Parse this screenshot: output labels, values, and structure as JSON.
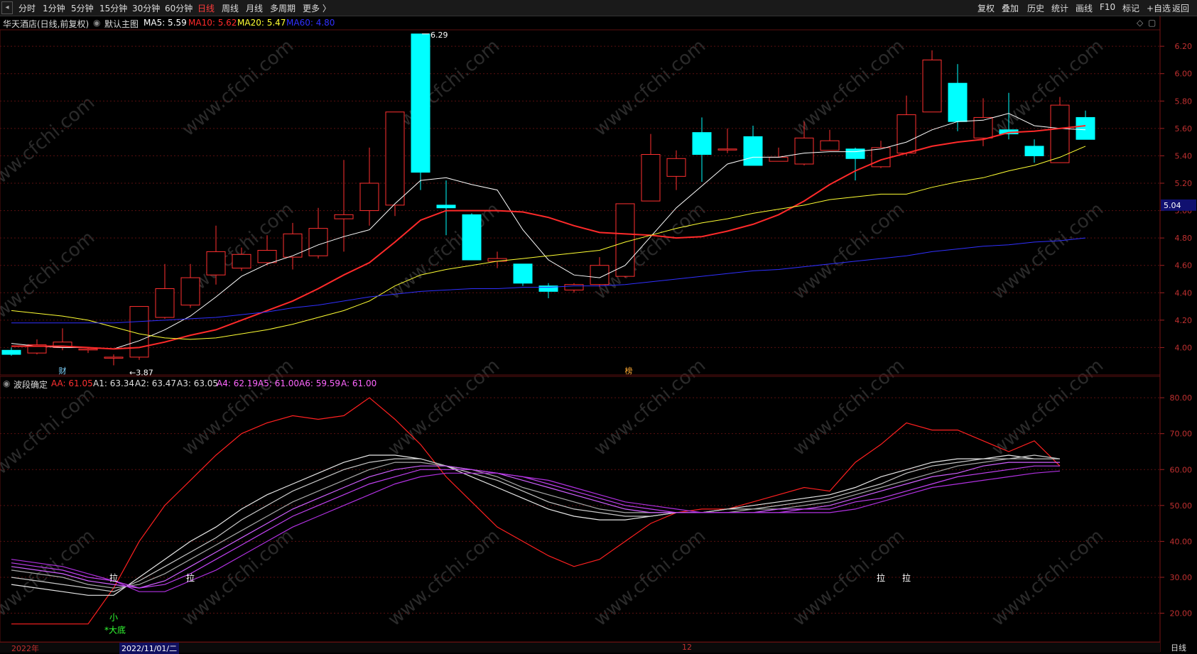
{
  "toolbar": {
    "periods": [
      "分时",
      "1分钟",
      "5分钟",
      "15分钟",
      "30分钟",
      "60分钟",
      "日线",
      "周线",
      "月线",
      "多周期",
      "更多"
    ],
    "active_period": "日线",
    "more_arrow": "〉",
    "right_tools": [
      "复权",
      "叠加",
      "历史",
      "统计",
      "画线",
      "F10",
      "标记",
      "+自选",
      "返回"
    ]
  },
  "main_panel": {
    "stock_name": "华天酒店(日线,前复权)",
    "template": "默认主图",
    "ma": [
      {
        "label": "MA5: 5.59",
        "color": "#ffffff"
      },
      {
        "label": "MA10: 5.62",
        "color": "#ff2a2a"
      },
      {
        "label": "MA20: 5.47",
        "color": "#ffff33"
      },
      {
        "label": "MA60: 4.80",
        "color": "#3030ff"
      }
    ],
    "high_label": "6.29",
    "low_label": "3.87",
    "current_price": "5.04",
    "badge_cai": "财",
    "badge_bang": "榜"
  },
  "indicator_panel": {
    "name": "波段确定",
    "values": [
      {
        "label": "AA: 61.05",
        "color": "#ff3030"
      },
      {
        "label": "A1: 63.34",
        "color": "#dddddd"
      },
      {
        "label": "A2: 63.47",
        "color": "#dddddd"
      },
      {
        "label": "A3: 63.05",
        "color": "#dddddd"
      },
      {
        "label": "A4: 62.19",
        "color": "#ff66ff"
      },
      {
        "label": "A5: 61.00",
        "color": "#ff66ff"
      },
      {
        "label": "A6: 59.59",
        "color": "#ff66ff"
      },
      {
        "label": "A: 61.00",
        "color": "#ff66ff"
      }
    ],
    "signals": [
      {
        "text": "拉",
        "i": 4
      },
      {
        "text": "拉",
        "i": 7
      },
      {
        "text": "拉",
        "i": 34
      },
      {
        "text": "拉",
        "i": 35
      }
    ],
    "small_label": "小",
    "bottom_label": "*大底"
  },
  "watermark": "www.cfchi.com",
  "x_axis": {
    "year_label": "2022年",
    "cursor_date": "2022/11/01/二",
    "month_label": "12",
    "period_label": "日线"
  },
  "chart_data": [
    {
      "type": "candlestick",
      "title": "华天酒店(日线,前复权)",
      "ylim": [
        3.8,
        6.32
      ],
      "yticks": [
        4.0,
        4.2,
        4.4,
        4.6,
        4.8,
        5.0,
        5.2,
        5.4,
        5.6,
        5.8,
        6.0,
        6.2
      ],
      "candles": [
        {
          "o": 3.98,
          "c": 3.95,
          "h": 4.0,
          "l": 3.94
        },
        {
          "o": 3.96,
          "c": 4.02,
          "h": 4.06,
          "l": 3.95
        },
        {
          "o": 4.0,
          "c": 4.04,
          "h": 4.14,
          "l": 3.98
        },
        {
          "o": 3.99,
          "c": 3.99,
          "h": 4.0,
          "l": 3.96
        },
        {
          "o": 3.93,
          "c": 3.93,
          "h": 3.95,
          "l": 3.87
        },
        {
          "o": 3.93,
          "c": 4.3,
          "h": 4.3,
          "l": 3.91
        },
        {
          "o": 4.22,
          "c": 4.43,
          "h": 4.61,
          "l": 4.21
        },
        {
          "o": 4.31,
          "c": 4.51,
          "h": 4.61,
          "l": 4.29
        },
        {
          "o": 4.53,
          "c": 4.7,
          "h": 4.89,
          "l": 4.46
        },
        {
          "o": 4.58,
          "c": 4.68,
          "h": 4.73,
          "l": 4.56
        },
        {
          "o": 4.62,
          "c": 4.71,
          "h": 4.82,
          "l": 4.6
        },
        {
          "o": 4.66,
          "c": 4.83,
          "h": 4.91,
          "l": 4.57
        },
        {
          "o": 4.67,
          "c": 4.87,
          "h": 5.02,
          "l": 4.65
        },
        {
          "o": 4.94,
          "c": 4.97,
          "h": 5.37,
          "l": 4.7
        },
        {
          "o": 5.0,
          "c": 5.2,
          "h": 5.46,
          "l": 4.89
        },
        {
          "o": 5.04,
          "c": 5.72,
          "h": 5.72,
          "l": 4.96
        },
        {
          "o": 6.29,
          "c": 5.28,
          "h": 6.29,
          "l": 5.15
        },
        {
          "o": 5.04,
          "c": 5.02,
          "h": 5.22,
          "l": 4.82
        },
        {
          "o": 4.97,
          "c": 4.64,
          "h": 4.98,
          "l": 4.64
        },
        {
          "o": 4.63,
          "c": 4.65,
          "h": 4.7,
          "l": 4.58
        },
        {
          "o": 4.61,
          "c": 4.47,
          "h": 4.61,
          "l": 4.45
        },
        {
          "o": 4.45,
          "c": 4.41,
          "h": 4.47,
          "l": 4.36
        },
        {
          "o": 4.42,
          "c": 4.46,
          "h": 4.47,
          "l": 4.4
        },
        {
          "o": 4.46,
          "c": 4.6,
          "h": 4.66,
          "l": 4.44
        },
        {
          "o": 4.52,
          "c": 5.05,
          "h": 5.05,
          "l": 4.51
        },
        {
          "o": 5.07,
          "c": 5.41,
          "h": 5.56,
          "l": 5.07
        },
        {
          "o": 5.25,
          "c": 5.38,
          "h": 5.44,
          "l": 5.15
        },
        {
          "o": 5.57,
          "c": 5.41,
          "h": 5.68,
          "l": 5.21
        },
        {
          "o": 5.45,
          "c": 5.45,
          "h": 5.6,
          "l": 5.42
        },
        {
          "o": 5.54,
          "c": 5.33,
          "h": 5.62,
          "l": 5.33
        },
        {
          "o": 5.36,
          "c": 5.39,
          "h": 5.46,
          "l": 5.36
        },
        {
          "o": 5.34,
          "c": 5.53,
          "h": 5.65,
          "l": 5.33
        },
        {
          "o": 5.44,
          "c": 5.51,
          "h": 5.59,
          "l": 5.44
        },
        {
          "o": 5.45,
          "c": 5.38,
          "h": 5.46,
          "l": 5.22
        },
        {
          "o": 5.32,
          "c": 5.46,
          "h": 5.51,
          "l": 5.31
        },
        {
          "o": 5.42,
          "c": 5.7,
          "h": 5.84,
          "l": 5.4
        },
        {
          "o": 5.72,
          "c": 6.1,
          "h": 6.17,
          "l": 5.72
        },
        {
          "o": 5.93,
          "c": 5.65,
          "h": 6.07,
          "l": 5.58
        },
        {
          "o": 5.53,
          "c": 5.68,
          "h": 5.82,
          "l": 5.47
        },
        {
          "o": 5.59,
          "c": 5.56,
          "h": 5.86,
          "l": 5.52
        },
        {
          "o": 5.47,
          "c": 5.4,
          "h": 5.52,
          "l": 5.35
        },
        {
          "o": 5.35,
          "c": 5.77,
          "h": 5.83,
          "l": 5.35
        },
        {
          "o": 5.68,
          "c": 5.52,
          "h": 5.73,
          "l": 5.52
        }
      ],
      "ma_series": [
        {
          "name": "MA5",
          "color": "#ffffff",
          "values": [
            4.03,
            4.01,
            4.0,
            4.0,
            3.99,
            4.05,
            4.13,
            4.23,
            4.37,
            4.52,
            4.61,
            4.67,
            4.75,
            4.81,
            4.86,
            5.05,
            5.22,
            5.24,
            5.19,
            5.15,
            4.86,
            4.64,
            4.53,
            4.51,
            4.6,
            4.81,
            5.02,
            5.18,
            5.34,
            5.39,
            5.39,
            5.42,
            5.43,
            5.43,
            5.45,
            5.5,
            5.59,
            5.65,
            5.66,
            5.71,
            5.62,
            5.6,
            5.59
          ]
        },
        {
          "name": "MA10",
          "color": "#ff2a2a",
          "values": [
            4.01,
            4.01,
            4.01,
            4.0,
            3.99,
            4.0,
            4.04,
            4.09,
            4.13,
            4.2,
            4.27,
            4.34,
            4.43,
            4.53,
            4.62,
            4.77,
            4.93,
            5.0,
            5.0,
            5.0,
            4.99,
            4.95,
            4.89,
            4.84,
            4.83,
            4.82,
            4.8,
            4.81,
            4.85,
            4.9,
            4.97,
            5.07,
            5.19,
            5.29,
            5.37,
            5.42,
            5.47,
            5.5,
            5.52,
            5.57,
            5.58,
            5.6,
            5.62
          ]
        },
        {
          "name": "MA20",
          "color": "#ffff33",
          "values": [
            4.27,
            4.25,
            4.23,
            4.2,
            4.15,
            4.1,
            4.07,
            4.06,
            4.07,
            4.1,
            4.13,
            4.17,
            4.22,
            4.27,
            4.34,
            4.45,
            4.53,
            4.57,
            4.6,
            4.63,
            4.65,
            4.67,
            4.69,
            4.71,
            4.77,
            4.82,
            4.87,
            4.91,
            4.94,
            4.98,
            5.01,
            5.04,
            5.08,
            5.1,
            5.12,
            5.12,
            5.17,
            5.21,
            5.24,
            5.29,
            5.33,
            5.39,
            5.47
          ]
        },
        {
          "name": "MA60",
          "color": "#3030ff",
          "values": [
            4.18,
            4.18,
            4.18,
            4.18,
            4.18,
            4.19,
            4.2,
            4.21,
            4.22,
            4.24,
            4.26,
            4.29,
            4.31,
            4.34,
            4.37,
            4.39,
            4.41,
            4.42,
            4.43,
            4.43,
            4.44,
            4.44,
            4.45,
            4.45,
            4.46,
            4.48,
            4.5,
            4.52,
            4.54,
            4.56,
            4.57,
            4.59,
            4.61,
            4.63,
            4.65,
            4.67,
            4.7,
            4.72,
            4.74,
            4.75,
            4.77,
            4.78,
            4.8
          ]
        }
      ]
    },
    {
      "type": "line",
      "title": "波段确定",
      "ylim": [
        12,
        82
      ],
      "yticks": [
        20,
        30,
        40,
        50,
        60,
        70,
        80
      ],
      "series": [
        {
          "name": "AA",
          "color": "#ff2020",
          "values": [
            17,
            17,
            17,
            17,
            27,
            40,
            50,
            57,
            64,
            70,
            73,
            75,
            74,
            75,
            80,
            74,
            67,
            58,
            51,
            44,
            40,
            36,
            33,
            35,
            40,
            45,
            48,
            49,
            49,
            51,
            53,
            55,
            54,
            62,
            67,
            73,
            71,
            71,
            68,
            65,
            68,
            61
          ]
        },
        {
          "name": "A1",
          "color": "#e8e8e8",
          "values": [
            28,
            27,
            26,
            25,
            25,
            30,
            35,
            40,
            44,
            49,
            53,
            56,
            59,
            62,
            64,
            64,
            63,
            61,
            58,
            55,
            52,
            49,
            47,
            46,
            46,
            47,
            48,
            48,
            49,
            50,
            51,
            52,
            53,
            55,
            58,
            60,
            62,
            63,
            63,
            64,
            63,
            63
          ]
        },
        {
          "name": "A2",
          "color": "#c8c8c8",
          "values": [
            30,
            29,
            28,
            27,
            26,
            29,
            33,
            37,
            41,
            46,
            50,
            54,
            57,
            60,
            62,
            63,
            63,
            61,
            59,
            57,
            54,
            51,
            49,
            48,
            47,
            47,
            48,
            48,
            49,
            49,
            50,
            51,
            52,
            54,
            56,
            59,
            61,
            62,
            63,
            63,
            64,
            63
          ]
        },
        {
          "name": "A3",
          "color": "#a8a8a8",
          "values": [
            32,
            31,
            30,
            28,
            27,
            28,
            31,
            35,
            39,
            43,
            47,
            51,
            54,
            57,
            60,
            62,
            62,
            61,
            60,
            58,
            55,
            53,
            51,
            49,
            48,
            48,
            48,
            48,
            48,
            49,
            49,
            50,
            51,
            53,
            55,
            57,
            59,
            61,
            62,
            63,
            63,
            63
          ]
        },
        {
          "name": "A4",
          "color": "#d060ff",
          "values": [
            33,
            32,
            31,
            29,
            28,
            27,
            29,
            33,
            37,
            41,
            45,
            49,
            52,
            55,
            58,
            60,
            61,
            61,
            60,
            59,
            57,
            55,
            53,
            51,
            49,
            48,
            48,
            48,
            48,
            48,
            49,
            49,
            50,
            52,
            54,
            56,
            58,
            59,
            61,
            62,
            62,
            62
          ]
        },
        {
          "name": "A5",
          "color": "#c040f0",
          "values": [
            34,
            33,
            32,
            30,
            29,
            27,
            28,
            31,
            35,
            39,
            43,
            47,
            50,
            53,
            56,
            58,
            60,
            60,
            60,
            59,
            58,
            56,
            54,
            52,
            50,
            49,
            48,
            48,
            48,
            48,
            48,
            49,
            49,
            51,
            52,
            54,
            56,
            58,
            59,
            60,
            61,
            61
          ]
        },
        {
          "name": "A6",
          "color": "#b030e0",
          "values": [
            35,
            34,
            33,
            31,
            29,
            26,
            26,
            29,
            32,
            36,
            40,
            44,
            47,
            50,
            53,
            56,
            58,
            59,
            59,
            59,
            58,
            57,
            55,
            53,
            51,
            50,
            49,
            48,
            48,
            48,
            48,
            48,
            48,
            49,
            51,
            53,
            55,
            56,
            57,
            58,
            59,
            59.6
          ]
        }
      ]
    }
  ]
}
